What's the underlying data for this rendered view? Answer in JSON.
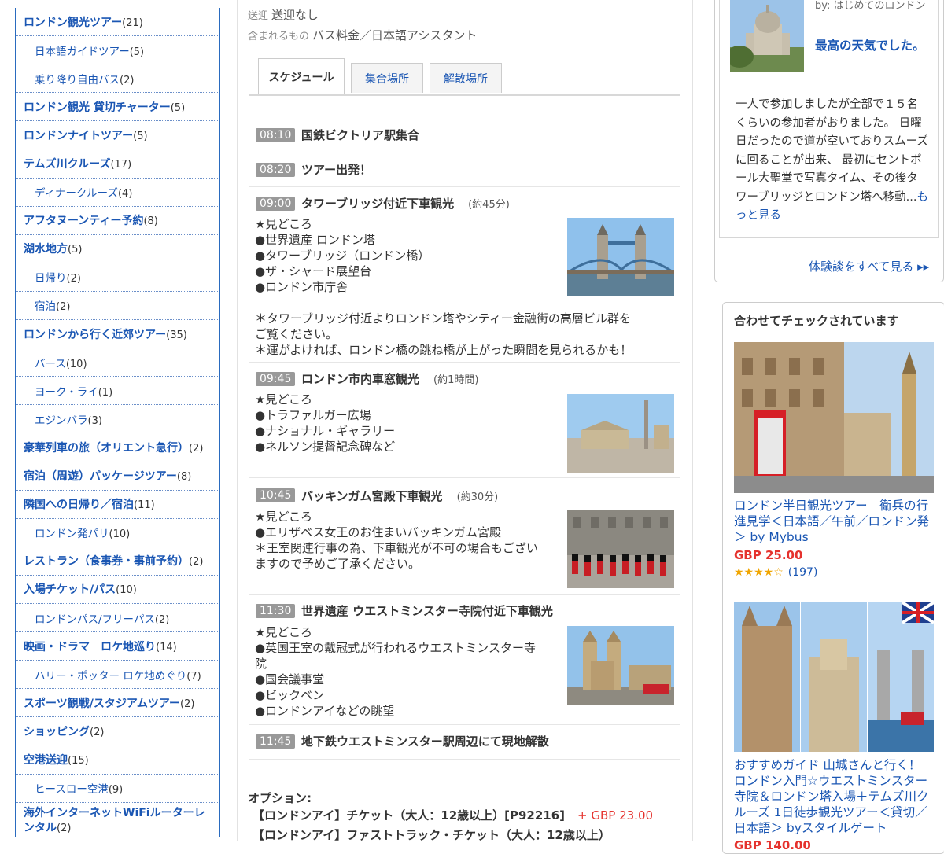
{
  "sidebar": {
    "items": [
      {
        "label": "ロンドン観光ツアー",
        "count": "(21)",
        "level": "top"
      },
      {
        "label": "日本語ガイドツアー",
        "count": "(5)",
        "level": "sub"
      },
      {
        "label": "乗り降り自由バス",
        "count": "(2)",
        "level": "sub"
      },
      {
        "label": "ロンドン観光 貸切チャーター",
        "count": "(5)",
        "level": "top"
      },
      {
        "label": "ロンドンナイトツアー",
        "count": "(5)",
        "level": "top"
      },
      {
        "label": "テムズ川クルーズ",
        "count": "(17)",
        "level": "top"
      },
      {
        "label": "ディナークルーズ",
        "count": "(4)",
        "level": "sub"
      },
      {
        "label": "アフタヌーンティー予約",
        "count": "(8)",
        "level": "top"
      },
      {
        "label": "湖水地方",
        "count": "(5)",
        "level": "top"
      },
      {
        "label": "日帰り",
        "count": "(2)",
        "level": "sub"
      },
      {
        "label": "宿泊",
        "count": "(2)",
        "level": "sub"
      },
      {
        "label": "ロンドンから行く近郊ツアー",
        "count": "(35)",
        "level": "top"
      },
      {
        "label": "バース",
        "count": "(10)",
        "level": "sub"
      },
      {
        "label": "ヨーク・ライ",
        "count": "(1)",
        "level": "sub"
      },
      {
        "label": "エジンバラ",
        "count": "(3)",
        "level": "sub"
      },
      {
        "label": "豪華列車の旅（オリエント急行）",
        "count": "(2)",
        "level": "top"
      },
      {
        "label": "宿泊（周遊）パッケージツアー",
        "count": "(8)",
        "level": "top"
      },
      {
        "label": "隣国への日帰り／宿泊",
        "count": "(11)",
        "level": "top"
      },
      {
        "label": "ロンドン発パリ",
        "count": "(10)",
        "level": "sub"
      },
      {
        "label": "レストラン（食事券・事前予約）",
        "count": "(2)",
        "level": "top"
      },
      {
        "label": "入場チケット/パス",
        "count": "(10)",
        "level": "top"
      },
      {
        "label": "ロンドンパス/フリーパス",
        "count": "(2)",
        "level": "sub"
      },
      {
        "label": "映画・ドラマ　ロケ地巡り",
        "count": "(14)",
        "level": "top"
      },
      {
        "label": "ハリー・ポッター ロケ地めぐり",
        "count": "(7)",
        "level": "sub"
      },
      {
        "label": "スポーツ観戦/スタジアムツアー",
        "count": "(2)",
        "level": "top"
      },
      {
        "label": "ショッピング",
        "count": "(2)",
        "level": "top"
      },
      {
        "label": "空港送迎",
        "count": "(15)",
        "level": "top"
      },
      {
        "label": "ヒースロー空港",
        "count": "(9)",
        "level": "sub"
      },
      {
        "label": "海外インターネットWiFiルーターレンタル",
        "count": "(2)",
        "level": "top"
      }
    ]
  },
  "tour": {
    "pickup_key": "送迎",
    "pickup_value": "送迎なし",
    "includes_key": "含まれるもの",
    "includes_value": "バス料金／日本語アシスタント",
    "tabs": [
      "スケジュール",
      "集合場所",
      "解散場所"
    ],
    "schedule": [
      {
        "time": "08:10",
        "title": "国鉄ビクトリア駅集合",
        "duration": "",
        "lines": [],
        "note": []
      },
      {
        "time": "08:20",
        "title": "ツアー出発！",
        "duration": "",
        "lines": [],
        "note": []
      },
      {
        "time": "09:00",
        "title": "タワーブリッジ付近下車観光",
        "duration": "(約45分)",
        "lines": [
          "★見どころ",
          "●世界遺産 ロンドン塔",
          "●タワーブリッジ（ロンドン橋）",
          "●ザ・シャード展望台",
          "●ロンドン市庁舎"
        ],
        "note": [
          "＊タワーブリッジ付近よりロンドン塔やシティー金融街の高層ビル群を",
          "ご覧ください。",
          "＊運がよければ、ロンドン橋の跳ね橋が上がった瞬間を見られるかも！"
        ]
      },
      {
        "time": "09:45",
        "title": "ロンドン市内車窓観光",
        "duration": "(約1時間)",
        "lines": [
          "★見どころ",
          "●トラファルガー広場",
          "●ナショナル・ギャラリー",
          "●ネルソン提督記念碑など"
        ],
        "note": []
      },
      {
        "time": "10:45",
        "title": "バッキンガム宮殿下車観光",
        "duration": "(約30分)",
        "lines": [
          "★見どころ",
          "●エリザベス女王のお住まいバッキンガム宮殿",
          "＊王室関連行事の為、下車観光が不可の場合もござい",
          "ますので予めご了承ください。"
        ],
        "note": []
      },
      {
        "time": "11:30",
        "title": "世界遺産 ウエストミンスター寺院付近下車観光",
        "duration": "",
        "lines": [
          "★見どころ",
          "●英国王室の戴冠式が行われるウエストミンスター寺",
          "院",
          "●国会議事堂",
          "●ビックベン",
          "●ロンドンアイなどの眺望"
        ],
        "note": []
      },
      {
        "time": "11:45",
        "title": "地下鉄ウエストミンスター駅周辺にて現地解散",
        "duration": "",
        "lines": [],
        "note": []
      }
    ],
    "options_title": "オプション:",
    "options": [
      {
        "label": "【ロンドンアイ】チケット（大人：12歳以上）[P92216]",
        "price": "+ GBP 23.00"
      },
      {
        "label": "【ロンドンアイ】ファストトラック・チケット（大人：12歳以上）",
        "price": ""
      }
    ]
  },
  "review": {
    "byline": "by: はじめてのロンドン",
    "title": "最高の天気でした。",
    "text": "一人で参加しましたが全部で１５名くらいの参加者がおりました。 日曜日だったので道が空いておりスムーズに回ることが出来、 最初にセントポール大聖堂で写真タイム、その後タワーブリッジとロンドン塔へ移動...",
    "more": "もっと見る",
    "see_all": "体験談をすべて見る ▸▸"
  },
  "recommend": {
    "heading": "合わせてチェックされています",
    "items": [
      {
        "title": "ロンドン半日観光ツアー　衛兵の行進見学＜日本語／午前／ロンドン発＞ by Mybus",
        "price": "GBP 25.00",
        "stars": "★★★★☆",
        "reviews": "(197)"
      },
      {
        "title": "おすすめガイド 山城さんと行く！ロンドン入門☆ウエストミンスター寺院＆ロンドン塔入場＋テムズ川クルーズ 1日徒歩観光ツアー＜貸切／日本語＞ byスタイルゲート",
        "price": "GBP 140.00",
        "stars": "",
        "reviews": ""
      }
    ]
  }
}
